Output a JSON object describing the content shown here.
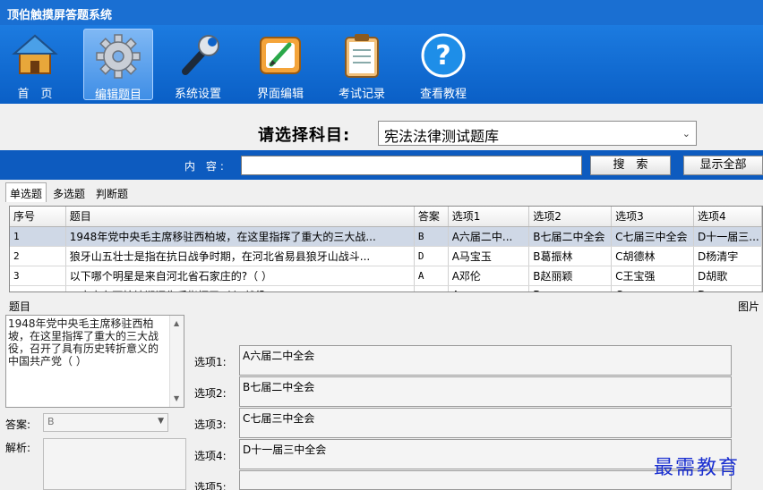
{
  "app": {
    "title": "顶伯触摸屏答题系统"
  },
  "toolbar": [
    {
      "label": "首　页",
      "icon": "home-icon"
    },
    {
      "label": "编辑题目",
      "icon": "gear-icon"
    },
    {
      "label": "系统设置",
      "icon": "wrench-icon"
    },
    {
      "label": "界面编辑",
      "icon": "edit-icon"
    },
    {
      "label": "考试记录",
      "icon": "clipboard-icon"
    },
    {
      "label": "查看教程",
      "icon": "help-icon"
    }
  ],
  "subject": {
    "label": "请选择科目:",
    "value": "宪法法律测试题库"
  },
  "search": {
    "label": "内  容:",
    "value": "",
    "search_btn": "搜　索",
    "show_all_btn": "显示全部"
  },
  "tabs": [
    "单选题",
    "多选题",
    "判断题"
  ],
  "table": {
    "headers": [
      "序号",
      "题目",
      "答案",
      "选项1",
      "选项2",
      "选项3",
      "选项4"
    ],
    "rows": [
      [
        "1",
        "1948年党中央毛主席移驻西柏坡，在这里指挥了重大的三大战...",
        "B",
        "A六届二中...",
        "B七届二中全会",
        "C七届三中全会",
        "D十一届三..."
      ],
      [
        "2",
        "狼牙山五壮士是指在抗日战争时期，在河北省易县狼牙山战斗...",
        "D",
        "A马宝玉",
        "B葛振林",
        "C胡德林",
        "D杨清宇"
      ],
      [
        "3",
        "以下哪个明星是来自河北省石家庄的?（    ）",
        "A",
        "A邓伦",
        "B赵丽颖",
        "C王宝强",
        "D胡歌"
      ],
      [
        "4",
        "...中央在西柏坡期间先后指挥了（    ）战役",
        "",
        "A...",
        "B...",
        "C...",
        "D..."
      ]
    ]
  },
  "detail": {
    "question_label": "题目",
    "question_text": "1948年党中央毛主席移驻西柏坡，在这里指挥了重大的三大战役，召开了具有历史转折意义的中国共产党（    ）",
    "answer_label": "答案:",
    "answer_value": "B",
    "analysis_label": "解析:",
    "image_label": "图片",
    "options": [
      {
        "label": "选项1:",
        "value": "A六届二中全会"
      },
      {
        "label": "选项2:",
        "value": "B七届二中全会"
      },
      {
        "label": "选项3:",
        "value": "C七届三中全会"
      },
      {
        "label": "选项4:",
        "value": "D十一届三中全会"
      },
      {
        "label": "选项5:",
        "value": ""
      }
    ]
  },
  "watermark": "最需教育"
}
